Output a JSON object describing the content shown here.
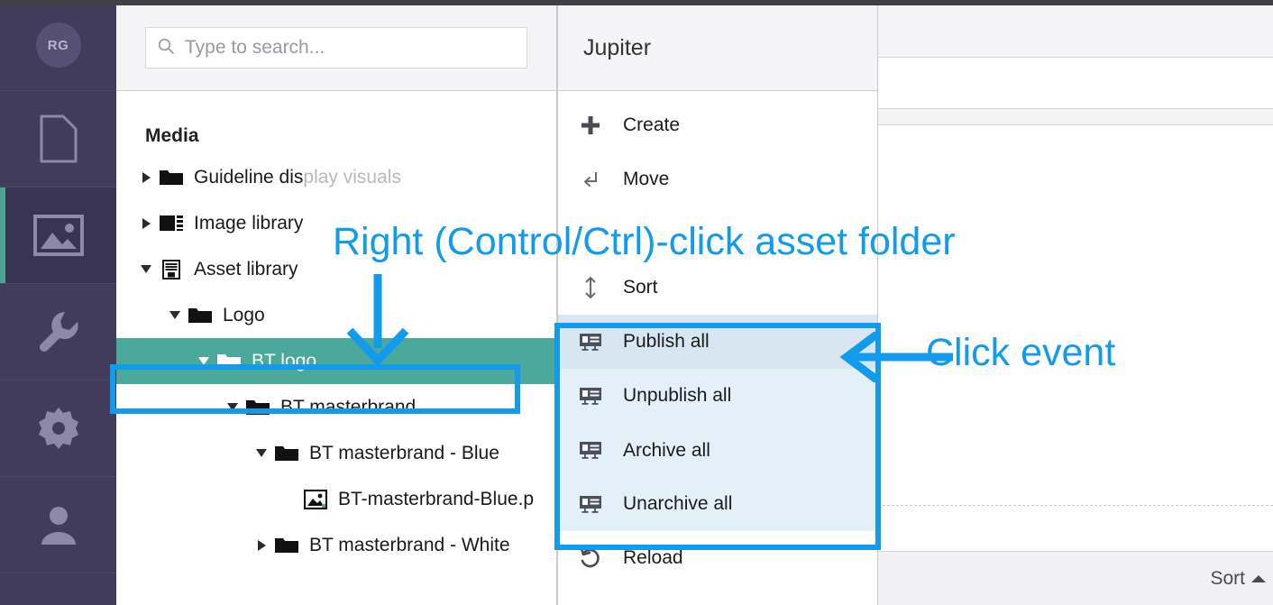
{
  "app": {
    "avatar_initials": "RG",
    "accent_teal": "#4aa99a",
    "accent_blue": "#129bec",
    "rail_bg": "#413b5c"
  },
  "rail": {
    "items": [
      {
        "name": "document-icon",
        "label": "Documents",
        "active": false
      },
      {
        "name": "image-icon",
        "label": "Media",
        "active": true
      },
      {
        "name": "wrench-icon",
        "label": "Tools",
        "active": false
      },
      {
        "name": "gear-icon",
        "label": "Settings",
        "active": false
      },
      {
        "name": "user-icon",
        "label": "Account",
        "active": false
      }
    ]
  },
  "search": {
    "value": "",
    "placeholder": "Type to search..."
  },
  "tree": {
    "title": "Media",
    "items": [
      {
        "label": "Guideline display visuals",
        "icon": "folder-icon",
        "caret": "right",
        "indent": 0,
        "selected": false,
        "faded_from": 13
      },
      {
        "label": "Image library",
        "icon": "film-icon",
        "caret": "right",
        "indent": 0,
        "selected": false
      },
      {
        "label": "Asset library",
        "icon": "archive-icon",
        "caret": "down",
        "indent": 0,
        "selected": false
      },
      {
        "label": "Logo",
        "icon": "folder-icon",
        "caret": "down",
        "indent": 1,
        "selected": false
      },
      {
        "label": "BT logo",
        "icon": "folder-icon",
        "caret": "down",
        "indent": 2,
        "selected": true
      },
      {
        "label": "BT masterbrand",
        "icon": "folder-icon",
        "caret": "down",
        "indent": 3,
        "selected": false
      },
      {
        "label": "BT masterbrand - Blue",
        "icon": "folder-icon",
        "caret": "down",
        "indent": 4,
        "selected": false
      },
      {
        "label": "BT-masterbrand-Blue.p",
        "icon": "image-file-icon",
        "caret": "none",
        "indent": 5,
        "selected": false
      },
      {
        "label": "BT masterbrand - White",
        "icon": "folder-icon",
        "caret": "right",
        "indent": 4,
        "selected": false
      }
    ]
  },
  "context_menu": {
    "header": "Jupiter",
    "items": [
      {
        "label": "Create",
        "icon": "plus-icon",
        "highlighted": false,
        "hover": false
      },
      {
        "label": "Move",
        "icon": "move-icon",
        "highlighted": false,
        "hover": false
      },
      {
        "label": "",
        "icon": "hidden-icon",
        "highlighted": false,
        "hover": false
      },
      {
        "label": "Sort",
        "icon": "sort-icon",
        "highlighted": false,
        "hover": false
      },
      {
        "label": "Publish all",
        "icon": "publish-icon",
        "highlighted": true,
        "hover": true
      },
      {
        "label": "Unpublish all",
        "icon": "publish-icon",
        "highlighted": true,
        "hover": false
      },
      {
        "label": "Archive all",
        "icon": "publish-icon",
        "highlighted": true,
        "hover": false,
        "separator": true
      },
      {
        "label": "Unarchive all",
        "icon": "publish-icon",
        "highlighted": true,
        "hover": false
      },
      {
        "label": "Reload",
        "icon": "reload-icon",
        "highlighted": false,
        "hover": false
      }
    ]
  },
  "content": {
    "footer_sort_label": "Sort"
  },
  "annotations": [
    {
      "name": "right-click-callout",
      "text": "Right (Control/Ctrl)-click asset folder"
    },
    {
      "name": "click-event-callout",
      "text": "Click event"
    }
  ]
}
